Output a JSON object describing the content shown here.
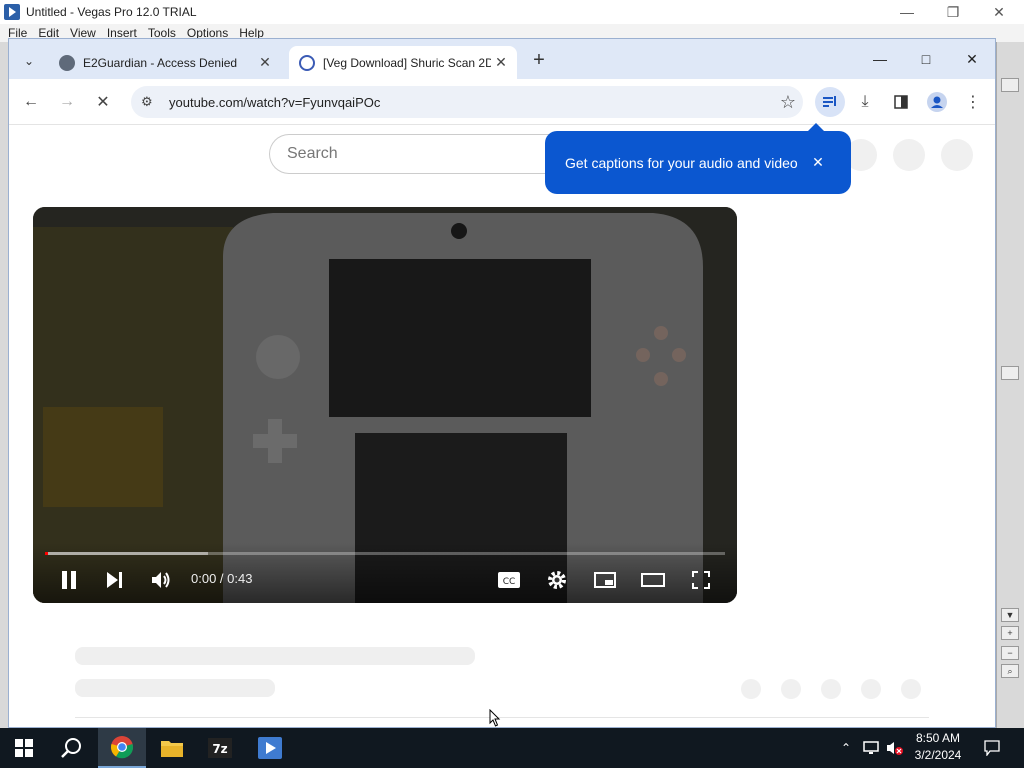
{
  "vegas": {
    "title": "Untitled - Vegas Pro 12.0 TRIAL",
    "menu": [
      "File",
      "Edit",
      "View",
      "Insert",
      "Tools",
      "Options",
      "Help"
    ]
  },
  "browser": {
    "tabs": [
      {
        "title": "E2Guardian - Access Denied",
        "active": false
      },
      {
        "title": "[Veg Download] Shuric Scan 2D",
        "active": true
      }
    ],
    "url": "youtube.com/watch?v=FyunvqaiPOc"
  },
  "page": {
    "search_placeholder": "Search",
    "callout_text": "Get captions for your audio and video",
    "player": {
      "time_display": "0:00 / 0:43",
      "loaded_fraction": 0.24,
      "played_fraction": 0.0
    }
  },
  "taskbar": {
    "time": "8:50 AM",
    "date": "3/2/2024",
    "apps": [
      "start-icon",
      "search-icon",
      "chrome-icon",
      "file-explorer-icon",
      "7zip-icon",
      "vegas-icon"
    ]
  },
  "colors": {
    "accent": "#0b57d0",
    "tabstrip": "#dfe8f7",
    "progress_played": "#ff0000",
    "taskbar": "#101820"
  }
}
